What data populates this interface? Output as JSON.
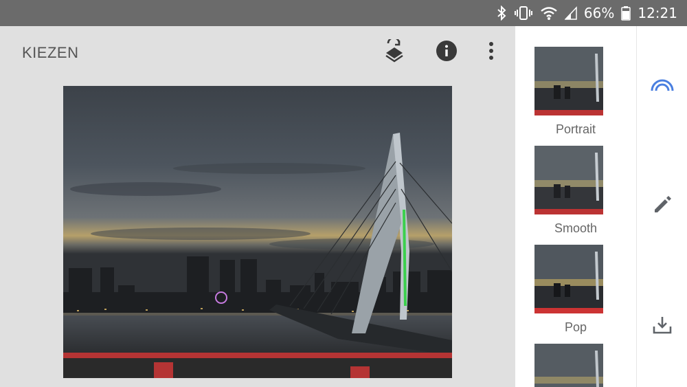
{
  "status": {
    "battery_percent": "66%",
    "time": "12:21",
    "icons": [
      "bluetooth-icon",
      "vibrate-icon",
      "wifi-icon",
      "cell-signal-icon",
      "battery-icon"
    ]
  },
  "editor": {
    "title": "KIEZEN",
    "toolbar_icons": [
      "stack-rotate-icon",
      "info-icon",
      "more-vert-icon"
    ]
  },
  "looks": {
    "items": [
      {
        "label": "Portrait"
      },
      {
        "label": "Smooth"
      },
      {
        "label": "Pop"
      },
      {
        "label": ""
      }
    ]
  },
  "rail": {
    "icons": [
      "looks-arc-icon",
      "edit-pencil-icon",
      "download-icon"
    ],
    "accent_color": "#4a7fe0"
  }
}
